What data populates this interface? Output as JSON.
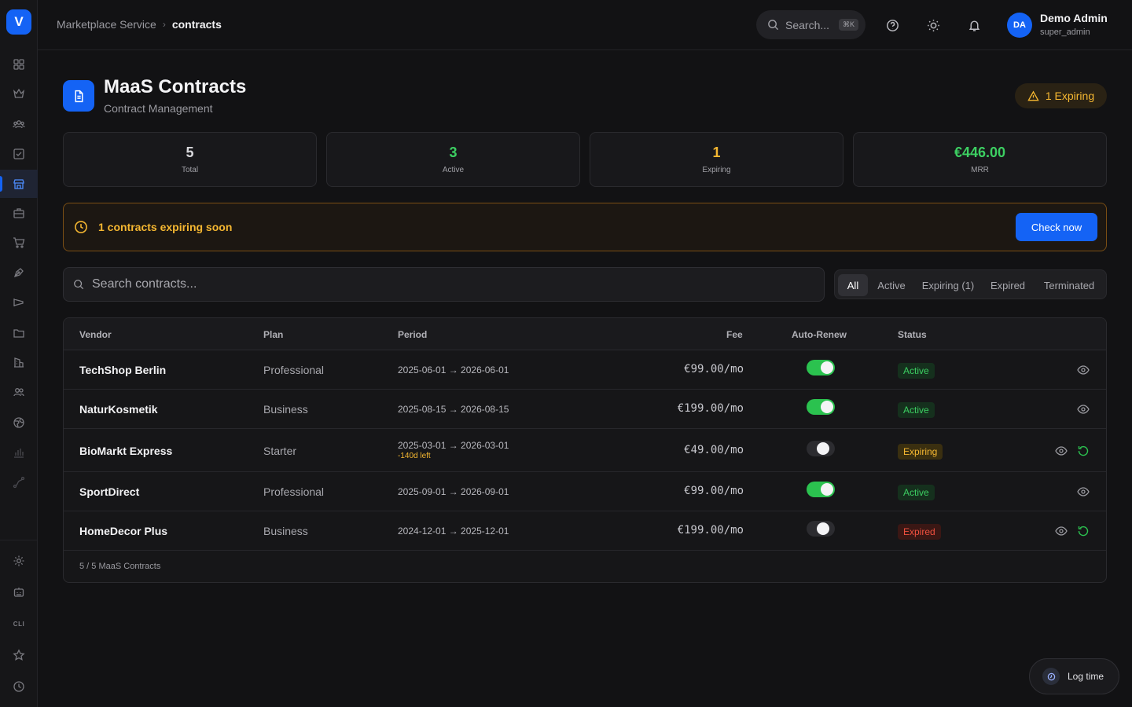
{
  "app": {
    "logo_letter": "V"
  },
  "breadcrumb": {
    "parent": "Marketplace Service",
    "separator": "›",
    "current": "contracts"
  },
  "topbar": {
    "search_label": "Search...",
    "search_shortcut": "⌘K",
    "user": {
      "initials": "DA",
      "name": "Demo Admin",
      "role": "super_admin"
    }
  },
  "header": {
    "title": "MaaS Contracts",
    "subtitle": "Contract Management",
    "expiring_badge": "1 Expiring"
  },
  "stats": [
    {
      "value": "5",
      "label": "Total",
      "color": "#d8d8dc"
    },
    {
      "value": "3",
      "label": "Active",
      "color": "#3ccf62"
    },
    {
      "value": "1",
      "label": "Expiring",
      "color": "#f5b731"
    },
    {
      "value": "€446.00",
      "label": "MRR",
      "color": "#3ccf62"
    }
  ],
  "alert": {
    "text": "1 contracts expiring soon",
    "button": "Check now"
  },
  "search": {
    "placeholder": "Search contracts..."
  },
  "filters": [
    "All",
    "Active",
    "Expiring (1)",
    "Expired",
    "Terminated"
  ],
  "table": {
    "headers": {
      "vendor": "Vendor",
      "plan": "Plan",
      "period": "Period",
      "fee": "Fee",
      "auto_renew": "Auto-Renew",
      "status": "Status"
    },
    "rows": [
      {
        "vendor": "TechShop Berlin",
        "plan": "Professional",
        "period": "2025-06-01 → 2026-06-01",
        "note": "",
        "fee": "€99.00/mo",
        "auto_renew": true,
        "status": "Active"
      },
      {
        "vendor": "NaturKosmetik",
        "plan": "Business",
        "period": "2025-08-15 → 2026-08-15",
        "note": "",
        "fee": "€199.00/mo",
        "auto_renew": true,
        "status": "Active"
      },
      {
        "vendor": "BioMarkt Express",
        "plan": "Starter",
        "period": "2025-03-01 → 2026-03-01",
        "note": "-140d left",
        "fee": "€49.00/mo",
        "auto_renew": false,
        "status": "Expiring"
      },
      {
        "vendor": "SportDirect",
        "plan": "Professional",
        "period": "2025-09-01 → 2026-09-01",
        "note": "",
        "fee": "€99.00/mo",
        "auto_renew": true,
        "status": "Active"
      },
      {
        "vendor": "HomeDecor Plus",
        "plan": "Business",
        "period": "2024-12-01 → 2025-12-01",
        "note": "",
        "fee": "€199.00/mo",
        "auto_renew": false,
        "status": "Expired"
      }
    ],
    "footer": "5 / 5 MaaS Contracts"
  },
  "sidebar": {
    "items": [
      {
        "icon": "dashboard-grid-icon"
      },
      {
        "icon": "crown-icon"
      },
      {
        "icon": "users-group-icon"
      },
      {
        "icon": "checkbox-icon"
      },
      {
        "icon": "store-icon",
        "active": true
      },
      {
        "icon": "briefcase-icon"
      },
      {
        "icon": "cart-icon"
      },
      {
        "icon": "pen-tool-icon"
      },
      {
        "icon": "megaphone-icon"
      },
      {
        "icon": "folder-icon"
      },
      {
        "icon": "building-icon"
      },
      {
        "icon": "team-icon"
      },
      {
        "icon": "globe-icon"
      },
      {
        "icon": "bar-chart-icon"
      },
      {
        "icon": "route-icon"
      }
    ],
    "bottom": [
      {
        "icon": "settings-icon"
      },
      {
        "icon": "robot-icon"
      },
      {
        "icon": "cli-icon",
        "label": "CLI"
      },
      {
        "icon": "star-icon"
      },
      {
        "icon": "clock-icon"
      }
    ]
  },
  "log_time": {
    "label": "Log time"
  }
}
